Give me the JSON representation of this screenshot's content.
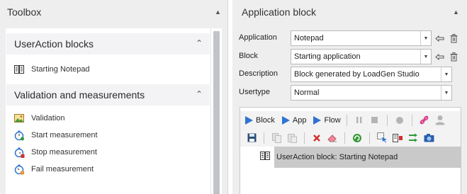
{
  "toolbox": {
    "title": "Toolbox",
    "groups": [
      {
        "title": "UserAction blocks",
        "items": [
          {
            "label": "Starting Notepad",
            "icon": "user-action-block-icon"
          }
        ]
      },
      {
        "title": "Validation and measurements",
        "items": [
          {
            "label": "Validation",
            "icon": "image-validation-icon"
          },
          {
            "label": "Start measurement",
            "icon": "stopwatch-start-icon"
          },
          {
            "label": "Stop measurement",
            "icon": "stopwatch-stop-icon"
          },
          {
            "label": "Fail measurement",
            "icon": "stopwatch-fail-icon"
          }
        ]
      }
    ]
  },
  "app_block": {
    "title": "Application block",
    "fields": {
      "application": {
        "label": "Application",
        "value": "Notepad"
      },
      "block": {
        "label": "Block",
        "value": "Starting application"
      },
      "description": {
        "label": "Description",
        "value": "Block generated by LoadGen Studio"
      },
      "usertype": {
        "label": "Usertype",
        "value": "Normal"
      }
    },
    "toolbar": {
      "block": "Block",
      "app": "App",
      "flow": "Flow"
    },
    "block_item": "UserAction block: Starting Notepad"
  },
  "colors": {
    "accent": "#2f73d2",
    "selection": "#c9c9c9",
    "pane": "#eeeeef"
  }
}
